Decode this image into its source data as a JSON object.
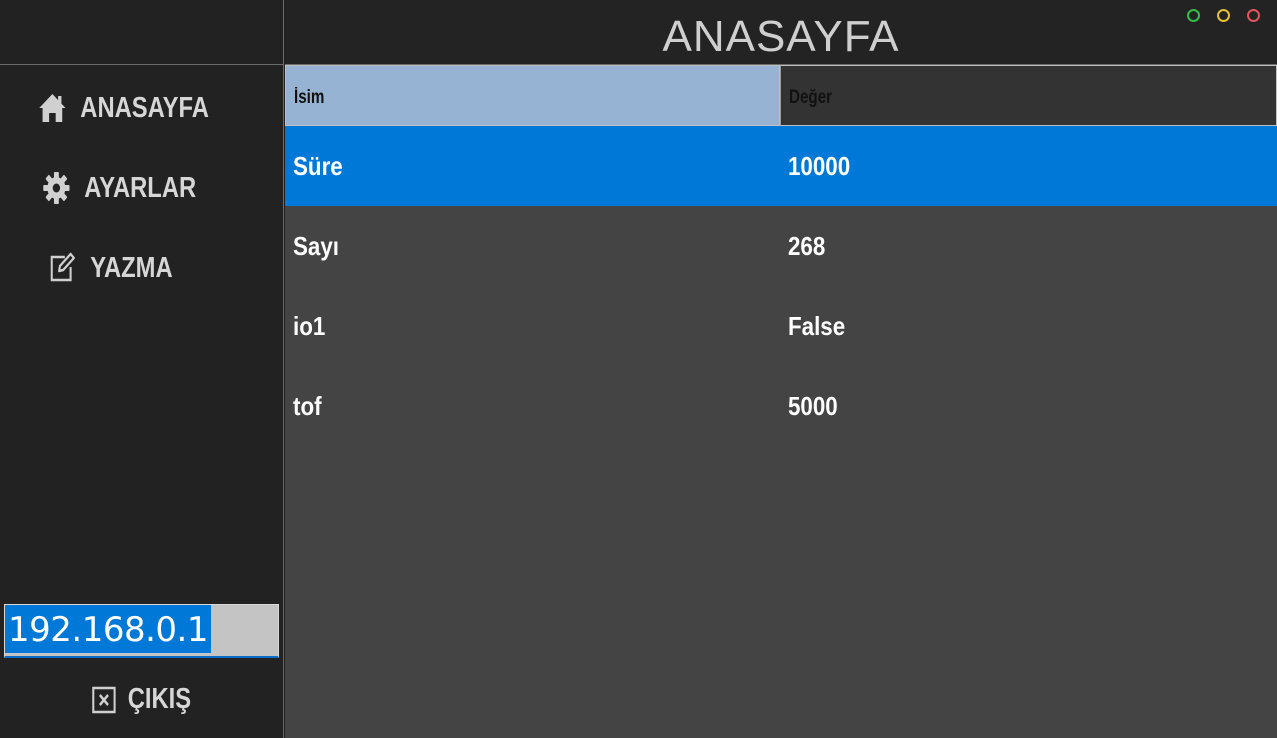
{
  "window": {
    "title": "ANASAYFA",
    "controls": [
      "maximize",
      "minimize",
      "close"
    ],
    "colors": {
      "green": "#2fbf4a",
      "yellow": "#e4c232",
      "red": "#e2555c"
    }
  },
  "sidebar": {
    "items": [
      {
        "label": "ANASAYFA",
        "icon": "home-icon"
      },
      {
        "label": "AYARLAR",
        "icon": "gear-icon"
      },
      {
        "label": "YAZMA",
        "icon": "edit-icon"
      }
    ],
    "ip_value": "192.168.0.1",
    "logout_label": "ÇIKIŞ",
    "logout_icon": "close-box-icon"
  },
  "table": {
    "columns": [
      "İsim",
      "Değer"
    ],
    "rows": [
      {
        "name": "Süre",
        "value": "10000",
        "selected": true
      },
      {
        "name": "Sayı",
        "value": "268",
        "selected": false
      },
      {
        "name": "io1",
        "value": "False",
        "selected": false
      },
      {
        "name": "tof",
        "value": "5000",
        "selected": false
      }
    ],
    "colors": {
      "selected_row": "#0078d7",
      "header_name": "#97b3d3"
    }
  }
}
